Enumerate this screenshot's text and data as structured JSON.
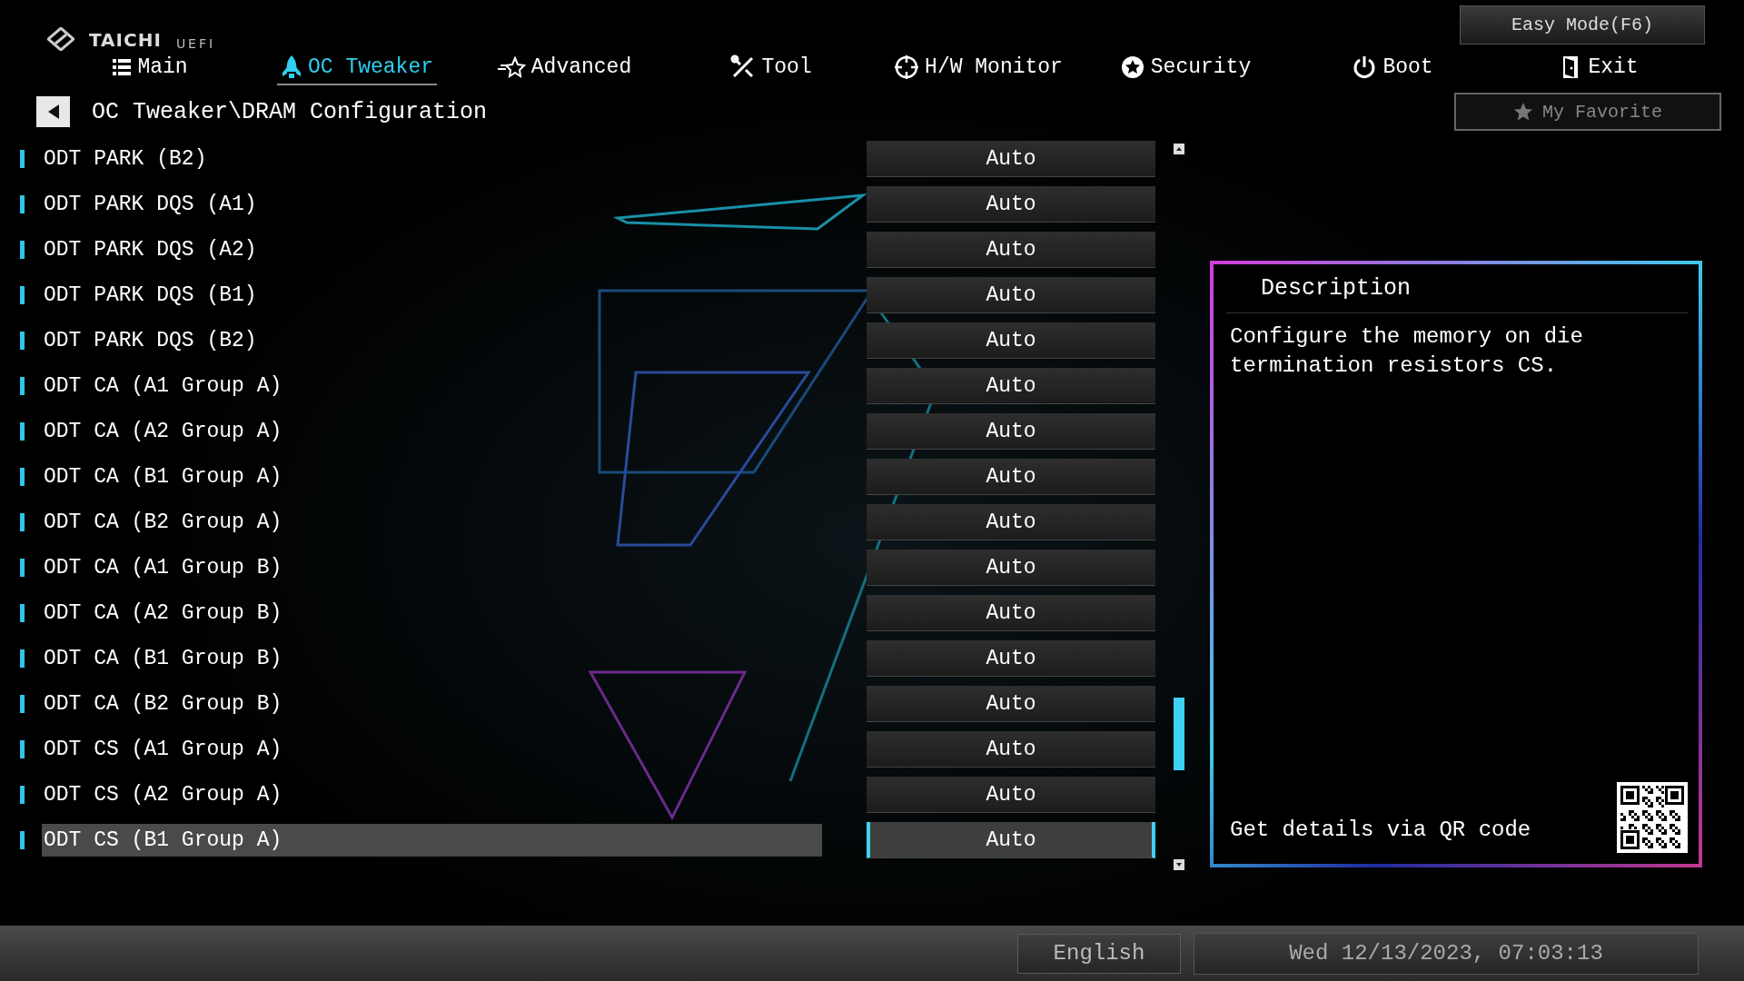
{
  "brand": {
    "logo": "TAICHI",
    "subtitle": "UEFI"
  },
  "easy_mode_button": "Easy Mode(F6)",
  "tabs": [
    {
      "label": "Main",
      "selected": false
    },
    {
      "label": "OC Tweaker",
      "selected": true
    },
    {
      "label": "Advanced",
      "selected": false
    },
    {
      "label": "Tool",
      "selected": false
    },
    {
      "label": "H/W Monitor",
      "selected": false
    },
    {
      "label": "Security",
      "selected": false
    },
    {
      "label": "Boot",
      "selected": false
    },
    {
      "label": "Exit",
      "selected": false
    }
  ],
  "breadcrumb": "OC Tweaker\\DRAM Configuration",
  "favorite_button": "My Favorite",
  "settings": [
    {
      "name": "ODT PARK (B2)",
      "value": "Auto",
      "selected": false
    },
    {
      "name": "ODT PARK DQS (A1)",
      "value": "Auto",
      "selected": false
    },
    {
      "name": "ODT PARK DQS (A2)",
      "value": "Auto",
      "selected": false
    },
    {
      "name": "ODT PARK DQS (B1)",
      "value": "Auto",
      "selected": false
    },
    {
      "name": "ODT PARK DQS (B2)",
      "value": "Auto",
      "selected": false
    },
    {
      "name": "ODT CA (A1 Group A)",
      "value": "Auto",
      "selected": false
    },
    {
      "name": "ODT CA (A2 Group A)",
      "value": "Auto",
      "selected": false
    },
    {
      "name": "ODT CA (B1 Group A)",
      "value": "Auto",
      "selected": false
    },
    {
      "name": "ODT CA (B2 Group A)",
      "value": "Auto",
      "selected": false
    },
    {
      "name": "ODT CA (A1 Group B)",
      "value": "Auto",
      "selected": false
    },
    {
      "name": "ODT CA (A2 Group B)",
      "value": "Auto",
      "selected": false
    },
    {
      "name": "ODT CA (B1 Group B)",
      "value": "Auto",
      "selected": false
    },
    {
      "name": "ODT CA (B2 Group B)",
      "value": "Auto",
      "selected": false
    },
    {
      "name": "ODT CS (A1 Group A)",
      "value": "Auto",
      "selected": false
    },
    {
      "name": "ODT CS (A2 Group A)",
      "value": "Auto",
      "selected": false
    },
    {
      "name": "ODT CS (B1 Group A)",
      "value": "Auto",
      "selected": true
    }
  ],
  "description": {
    "title": "Description",
    "text": "Configure the memory on die termination resistors CS.",
    "qr_hint": "Get details via QR code"
  },
  "status_bar": {
    "language": "English",
    "datetime": "Wed 12/13/2023, 07:03:13"
  }
}
